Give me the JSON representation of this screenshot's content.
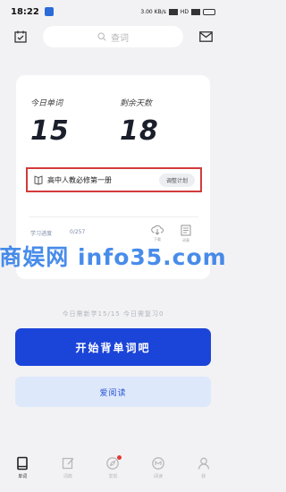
{
  "status_bar": {
    "time": "18:22",
    "signal_text": "3.00 KB/s",
    "network": "HD"
  },
  "header": {
    "search_placeholder": "查词"
  },
  "stats": {
    "today_words_label": "今日单词",
    "today_words_value": "15",
    "remaining_days_label": "剩余天数",
    "remaining_days_value": "18"
  },
  "book": {
    "name": "高中人教必修第一册",
    "plan_button_label": "调整计划"
  },
  "progress": {
    "label": "学习进度",
    "value": "0/257",
    "icons": [
      {
        "name": "download-icon",
        "label": "下载"
      },
      {
        "name": "wordlist-icon",
        "label": "词表"
      }
    ]
  },
  "watermark": {
    "text": "商娱网 info35.com"
  },
  "summary": {
    "text": "今日需新学15/15 今日需复习0"
  },
  "actions": {
    "start_label": "开始背单词吧",
    "read_label": "爱阅读"
  },
  "nav": {
    "items": [
      {
        "label": "单词",
        "icon": "book-icon"
      },
      {
        "label": "词典",
        "icon": "note-icon"
      },
      {
        "label": "发现",
        "icon": "compass-icon"
      },
      {
        "label": "阅读",
        "icon": "badge-icon"
      },
      {
        "label": "我",
        "icon": "person-icon"
      }
    ]
  },
  "colors": {
    "primary": "#1b44d8",
    "secondary_bg": "#dde8fb",
    "highlight_border": "#d23b3b",
    "watermark": "#2878e6"
  }
}
